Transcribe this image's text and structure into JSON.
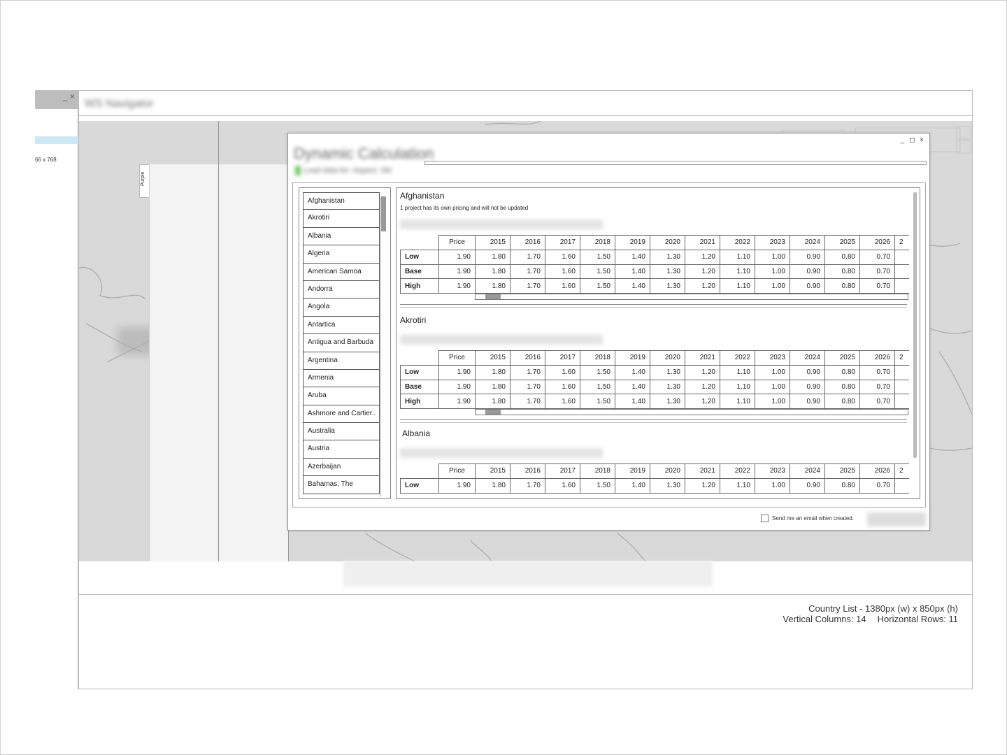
{
  "left_window": {
    "controls": "_ ×",
    "resolution": "66 x 768"
  },
  "main_window": {
    "title": "WS Navigator"
  },
  "side_tab": {
    "label": "Purple"
  },
  "dialog": {
    "controls": "_ ◻ ×",
    "title": "Dynamic Calculation",
    "subtitle": "Load data for: Aspect: 2M",
    "footer": {
      "email_label": "Send me an email when created."
    }
  },
  "countries": [
    "Afghanistan",
    "Akrotiri",
    "Albania",
    "Algeria",
    "American Samoa",
    "Andorra",
    "Angola",
    "Antartica",
    "Antigua and Barbuda",
    "Argentina",
    "Armenia",
    "Aruba",
    "Ashmore and Cartier..",
    "Australia",
    "Austria",
    "Azerbaijan",
    "Bahamas, The"
  ],
  "table_columns": {
    "price": "Price",
    "years": [
      "2015",
      "2016",
      "2017",
      "2018",
      "2019",
      "2020",
      "2021",
      "2022",
      "2023",
      "2024",
      "2025",
      "2026"
    ],
    "more": "2"
  },
  "sections": [
    {
      "title": "Afghanistan",
      "note": "1 project has its own pricing and will not be updated",
      "rows": [
        {
          "label": "Low",
          "price": "1.90",
          "values": [
            "1.80",
            "1.70",
            "1.60",
            "1.50",
            "1.40",
            "1.30",
            "1.20",
            "1.10",
            "1.00",
            "0.90",
            "0.80",
            "0.70"
          ]
        },
        {
          "label": "Base",
          "price": "1.90",
          "values": [
            "1.80",
            "1.70",
            "1.60",
            "1.50",
            "1.40",
            "1.30",
            "1.20",
            "1.10",
            "1.00",
            "0.90",
            "0.80",
            "0.70"
          ]
        },
        {
          "label": "High",
          "price": "1.90",
          "values": [
            "1.80",
            "1.70",
            "1.60",
            "1.50",
            "1.40",
            "1.30",
            "1.20",
            "1.10",
            "1.00",
            "0.90",
            "0.80",
            "0.70"
          ]
        }
      ]
    },
    {
      "title": "Akrotiri",
      "note": "",
      "rows": [
        {
          "label": "Low",
          "price": "1.90",
          "values": [
            "1.80",
            "1.70",
            "1.60",
            "1.50",
            "1.40",
            "1.30",
            "1.20",
            "1.10",
            "1.00",
            "0.90",
            "0.80",
            "0.70"
          ]
        },
        {
          "label": "Base",
          "price": "1.90",
          "values": [
            "1.80",
            "1.70",
            "1.60",
            "1.50",
            "1.40",
            "1.30",
            "1.20",
            "1.10",
            "1.00",
            "0.90",
            "0.80",
            "0.70"
          ]
        },
        {
          "label": "High",
          "price": "1.90",
          "values": [
            "1.80",
            "1.70",
            "1.60",
            "1.50",
            "1.40",
            "1.30",
            "1.20",
            "1.10",
            "1.00",
            "0.90",
            "0.80",
            "0.70"
          ]
        }
      ]
    },
    {
      "title": "Albania",
      "note": "",
      "rows": [
        {
          "label": "Low",
          "price": "1.90",
          "values": [
            "1.80",
            "1.70",
            "1.60",
            "1.50",
            "1.40",
            "1.30",
            "1.20",
            "1.10",
            "1.00",
            "0.90",
            "0.80",
            "0.70"
          ]
        }
      ]
    }
  ],
  "spec": {
    "line1": "Country List - 1380px (w) x 850px (h)",
    "columns": "Vertical Columns: 14",
    "rows": "Horizontal Rows: 11"
  }
}
